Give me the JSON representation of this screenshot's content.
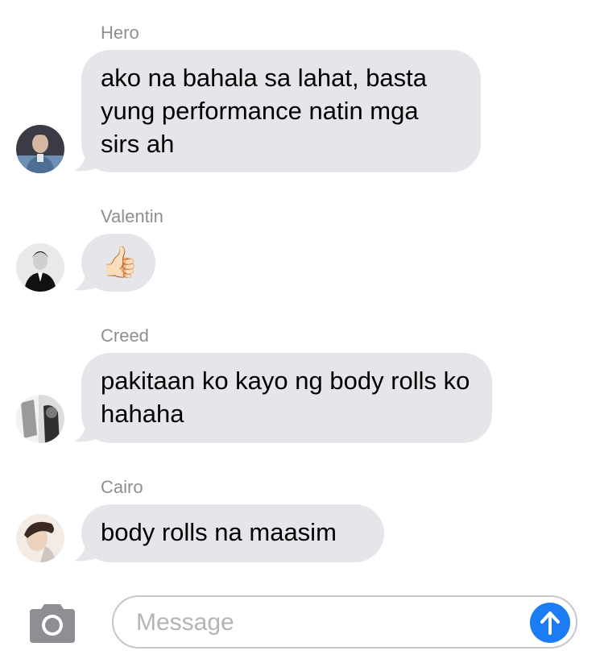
{
  "messages": [
    {
      "sender": "Hero",
      "text": "ako na bahala sa lahat, basta yung performance natin mga sirs ah",
      "avatar": "avatar-hero"
    },
    {
      "sender": "Valentin",
      "text": "👍🏻",
      "avatar": "avatar-valentin"
    },
    {
      "sender": "Creed",
      "text": "pakitaan ko kayo ng body rolls ko hahaha",
      "avatar": "avatar-creed"
    },
    {
      "sender": "Cairo",
      "text": "body rolls na maasim",
      "avatar": "avatar-cairo"
    }
  ],
  "composer": {
    "placeholder": "Message",
    "camera_icon": "camera-icon",
    "send_icon": "send-arrow-up-icon"
  },
  "colors": {
    "bubble": "#e5e5ea",
    "sender_name": "#8e8e93",
    "send_button": "#1c7cf4",
    "camera": "#8e8e93"
  }
}
